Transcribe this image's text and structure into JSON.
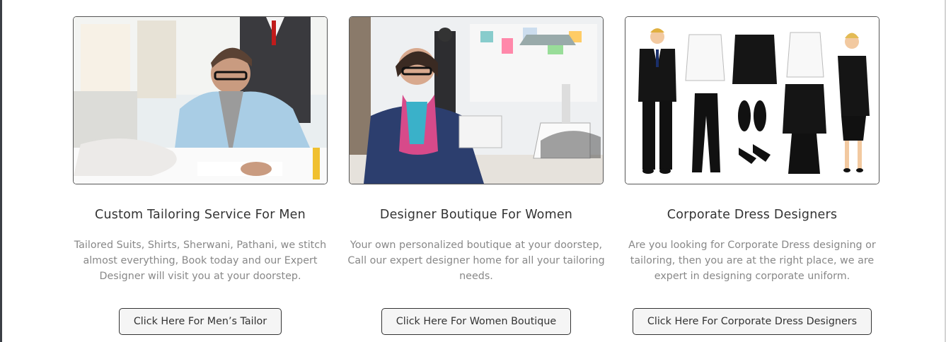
{
  "cards": [
    {
      "image_alt": "Tailor designing at desk",
      "title": "Custom Tailoring Service For Men",
      "description": "Tailored Suits, Shirts, Sherwani, Pathani, we stitch almost everything, Book today and our Expert Designer will visit you at your doorstep.",
      "button_label": "Click Here For Men’s Tailor"
    },
    {
      "image_alt": "Designer in boutique",
      "title": "Designer Boutique For Women",
      "description": "Your own personalized boutique at your doorstep, Call our expert designer home for all your tailoring needs.",
      "button_label": "Click Here For Women Boutique"
    },
    {
      "image_alt": "Corporate outfits illustration",
      "title": "Corporate Dress Designers",
      "description": "Are you looking for Corporate Dress designing or tailoring, then you are at the right place, we are expert in designing corporate uniform.",
      "button_label": "Click Here For Corporate Dress Designers"
    }
  ],
  "colors": {
    "title": "#333333",
    "description": "#888888",
    "button_border": "#333333",
    "button_bg": "#f5f5f5"
  }
}
